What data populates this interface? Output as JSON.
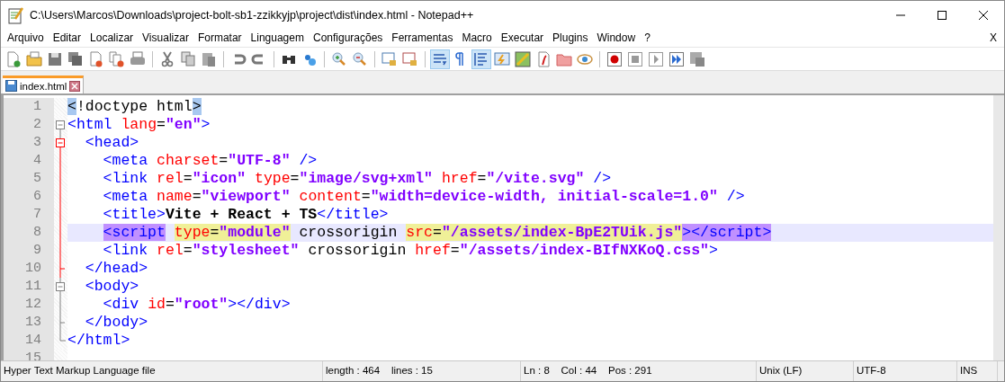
{
  "window": {
    "title": "C:\\Users\\Marcos\\Downloads\\project-bolt-sb1-zzikkyjp\\project\\dist\\index.html - Notepad++",
    "close_document": "X"
  },
  "menu": [
    "Arquivo",
    "Editar",
    "Localizar",
    "Visualizar",
    "Formatar",
    "Linguagem",
    "Configurações",
    "Ferramentas",
    "Macro",
    "Executar",
    "Plugins",
    "Window",
    "?"
  ],
  "toolbar": [
    {
      "pressed": false
    },
    {
      "pressed": false
    },
    {
      "pressed": false
    },
    {
      "pressed": false
    },
    {
      "pressed": false
    },
    {
      "pressed": false
    },
    {
      "pressed": false
    },
    {
      "pressed": false
    },
    {
      "pressed": false
    },
    {
      "pressed": false
    },
    {
      "pressed": false
    },
    {
      "pressed": false
    },
    {
      "pressed": false
    },
    {
      "pressed": false
    },
    {
      "pressed": false
    },
    {
      "pressed": false
    },
    {
      "pressed": false
    },
    {
      "pressed": false
    },
    {
      "pressed": true
    },
    {
      "pressed": false
    },
    {
      "pressed": true
    },
    {
      "pressed": false
    },
    {
      "pressed": false
    },
    {
      "pressed": false
    },
    {
      "pressed": false
    },
    {
      "pressed": false
    },
    {
      "pressed": false
    },
    {
      "pressed": false
    },
    {
      "pressed": false
    },
    {
      "pressed": false
    },
    {
      "pressed": false
    }
  ],
  "tabs": [
    {
      "label": "index.html",
      "selected": true
    }
  ],
  "lines": [
    {
      "number": "1",
      "current": false,
      "tokens": [
        {
          "kind": "text",
          "text": "<",
          "brace_match": true
        },
        {
          "kind": "text",
          "text": "!doctype html"
        },
        {
          "kind": "text",
          "text": ">",
          "brace_match": true
        }
      ]
    },
    {
      "number": "2",
      "fold_start": true,
      "in_fold": false,
      "fold_active": false,
      "current": false,
      "tokens": [
        {
          "kind": "tag",
          "text": "<html"
        },
        {
          "kind": "attr",
          "text": " lang"
        },
        {
          "kind": "op",
          "text": "="
        },
        {
          "kind": "value",
          "text": "\"en\""
        },
        {
          "kind": "tag",
          "text": ">"
        }
      ]
    },
    {
      "number": "3",
      "fold_start": true,
      "in_fold": true,
      "fold_active": true,
      "current": false,
      "tokens": [
        {
          "kind": "tag",
          "text": "  <head>"
        }
      ]
    },
    {
      "number": "4",
      "fold_start": false,
      "in_fold": true,
      "fold_end": false,
      "fold_active": true,
      "current": false,
      "tokens": [
        {
          "kind": "tag",
          "text": "    <meta"
        },
        {
          "kind": "attr",
          "text": " charset"
        },
        {
          "kind": "op",
          "text": "="
        },
        {
          "kind": "value",
          "text": "\"UTF-8\""
        },
        {
          "kind": "tag",
          "text": " />"
        }
      ]
    },
    {
      "number": "5",
      "fold_start": false,
      "in_fold": true,
      "fold_end": false,
      "fold_active": true,
      "current": false,
      "tokens": [
        {
          "kind": "tag",
          "text": "    <link"
        },
        {
          "kind": "attr",
          "text": " rel"
        },
        {
          "kind": "op",
          "text": "="
        },
        {
          "kind": "value",
          "text": "\"icon\""
        },
        {
          "kind": "attr",
          "text": " type"
        },
        {
          "kind": "op",
          "text": "="
        },
        {
          "kind": "value",
          "text": "\"image/svg+xml\""
        },
        {
          "kind": "attr",
          "text": " href"
        },
        {
          "kind": "op",
          "text": "="
        },
        {
          "kind": "value",
          "text": "\"/vite.svg\""
        },
        {
          "kind": "tag",
          "text": " />"
        }
      ]
    },
    {
      "number": "6",
      "fold_start": false,
      "in_fold": true,
      "fold_end": false,
      "fold_active": true,
      "current": false,
      "tokens": [
        {
          "kind": "tag",
          "text": "    <meta"
        },
        {
          "kind": "attr",
          "text": " name"
        },
        {
          "kind": "op",
          "text": "="
        },
        {
          "kind": "value",
          "text": "\"viewport\""
        },
        {
          "kind": "attr",
          "text": " content"
        },
        {
          "kind": "op",
          "text": "="
        },
        {
          "kind": "value",
          "text": "\"width=device-width, initial-scale=1.0\""
        },
        {
          "kind": "tag",
          "text": " />"
        }
      ]
    },
    {
      "number": "7",
      "fold_start": false,
      "in_fold": true,
      "fold_end": false,
      "fold_active": true,
      "current": false,
      "tokens": [
        {
          "kind": "tag",
          "text": "    <title>"
        },
        {
          "kind": "bold",
          "text": "Vite + React + TS"
        },
        {
          "kind": "tag",
          "text": "</title>"
        }
      ]
    },
    {
      "number": "8",
      "fold_start": false,
      "in_fold": true,
      "fold_end": false,
      "fold_active": true,
      "current": true,
      "tokens": [
        {
          "kind": "tag",
          "text": "    <script",
          "tag_match": true
        },
        {
          "kind": "attr",
          "text": " type",
          "smart_highlight": true
        },
        {
          "kind": "op",
          "text": "=",
          "smart_highlight": true
        },
        {
          "kind": "value",
          "text": "\"module\"",
          "smart_highlight": true
        },
        {
          "kind": "text",
          "text": " crossorigin "
        },
        {
          "kind": "attr",
          "text": "src",
          "smart_highlight": true
        },
        {
          "kind": "op",
          "text": "=",
          "smart_highlight": true
        },
        {
          "kind": "value",
          "text": "\"/assets/index-BpE2TUik.js\"",
          "smart_highlight": true
        },
        {
          "kind": "tag",
          "text": "></script>",
          "tag_match": true
        }
      ]
    },
    {
      "number": "9",
      "fold_start": false,
      "in_fold": true,
      "fold_end": false,
      "fold_active": true,
      "current": false,
      "tokens": [
        {
          "kind": "tag",
          "text": "    <link"
        },
        {
          "kind": "attr",
          "text": " rel"
        },
        {
          "kind": "op",
          "text": "="
        },
        {
          "kind": "value",
          "text": "\"stylesheet\""
        },
        {
          "kind": "text",
          "text": " crossorigin "
        },
        {
          "kind": "attr",
          "text": "href"
        },
        {
          "kind": "op",
          "text": "="
        },
        {
          "kind": "value",
          "text": "\"/assets/index-BIfNXKoQ.css\""
        },
        {
          "kind": "tag",
          "text": ">"
        }
      ]
    },
    {
      "number": "10",
      "fold_start": false,
      "in_fold": true,
      "fold_end": true,
      "fold_active": true,
      "current": false,
      "tokens": [
        {
          "kind": "tag",
          "text": "  </head>"
        }
      ]
    },
    {
      "number": "11",
      "fold_start": true,
      "in_fold": true,
      "fold_active": false,
      "current": false,
      "tokens": [
        {
          "kind": "tag",
          "text": "  <body>"
        }
      ]
    },
    {
      "number": "12",
      "fold_start": false,
      "in_fold": true,
      "fold_end": false,
      "fold_active": false,
      "current": false,
      "tokens": [
        {
          "kind": "tag",
          "text": "    <div"
        },
        {
          "kind": "attr",
          "text": " id"
        },
        {
          "kind": "op",
          "text": "="
        },
        {
          "kind": "value",
          "text": "\"root\""
        },
        {
          "kind": "tag",
          "text": "></div>"
        }
      ]
    },
    {
      "number": "13",
      "fold_start": false,
      "in_fold": true,
      "fold_end": true,
      "fold_active": false,
      "current": false,
      "tokens": [
        {
          "kind": "tag",
          "text": "  </body>"
        }
      ]
    },
    {
      "number": "14",
      "fold_start": false,
      "in_fold": false,
      "fold_end": true,
      "fold_active": false,
      "current": false,
      "tokens": [
        {
          "kind": "tag",
          "text": "</html>"
        }
      ]
    },
    {
      "number": "15",
      "current": false
    }
  ],
  "status_bar": [
    {
      "text": "Hyper Text Markup Language file"
    },
    {
      "text": "length : 464    lines : 15"
    },
    {
      "text": "Ln : 8    Col : 44    Pos : 291"
    },
    {
      "text": "Unix (LF)"
    },
    {
      "text": "UTF-8"
    },
    {
      "text": "INS"
    }
  ]
}
